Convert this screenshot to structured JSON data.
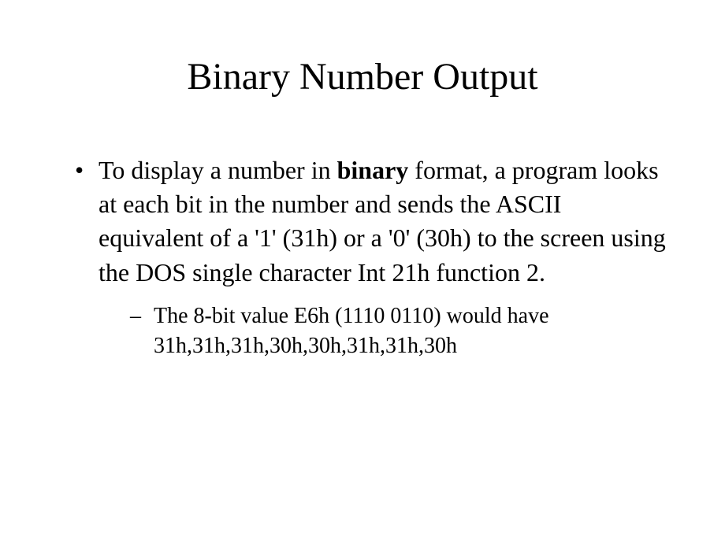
{
  "title": "Binary Number Output",
  "bullet": {
    "text_before": "To display a number in ",
    "bold_word": "binary",
    "text_after": " format,  a program looks at each bit in the number and sends the ASCII equivalent of a '1' (31h) or a '0' (30h) to the screen using the DOS single character Int 21h function 2."
  },
  "sub_bullet": "The 8-bit value E6h (1110 0110) would have 31h,31h,31h,30h,30h,31h,31h,30h"
}
